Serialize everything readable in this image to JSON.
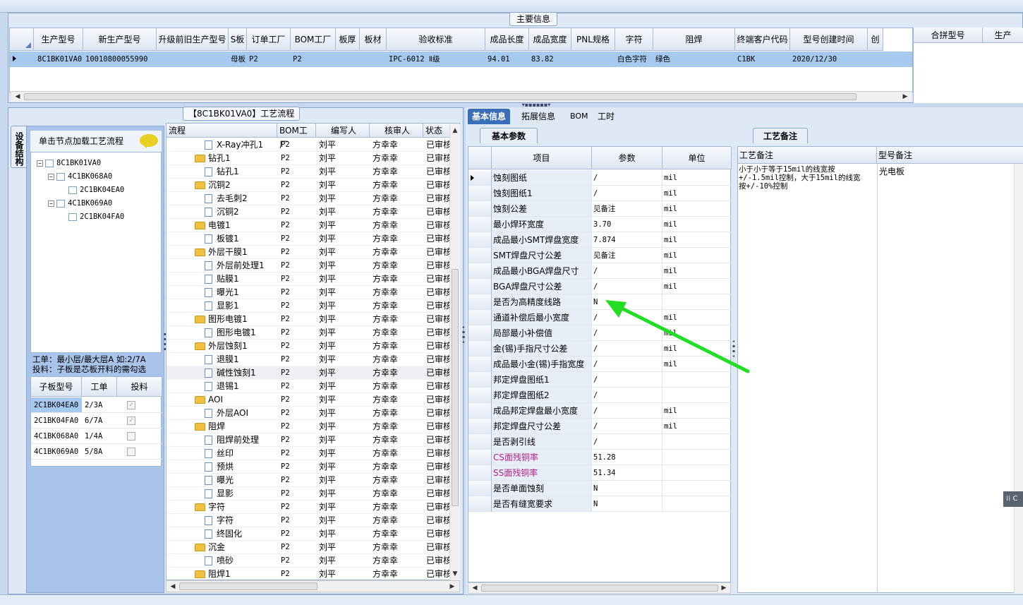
{
  "main_info": {
    "title": "主要信息",
    "columns": [
      "生产型号",
      "新生产型号",
      "升级前旧生产型号",
      "S板",
      "订单工厂",
      "BOM工厂",
      "板厚",
      "板材",
      "验收标准",
      "成品长度",
      "成品宽度",
      "PNL规格",
      "字符",
      "阻焊",
      "终端客户代码",
      "型号创建时间",
      "创"
    ],
    "row": [
      "8C1BK01VA0",
      "10010800055990",
      "",
      "母板",
      "P2",
      "P2",
      "",
      "",
      "IPC-6012 Ⅱ级",
      "94.01",
      "83.82",
      "",
      "白色字符",
      "绿色",
      "C1BK",
      "2020/12/30",
      ""
    ],
    "right_columns": [
      "合拼型号",
      "生产"
    ]
  },
  "process": {
    "title": "【8C1BK01VA0】工艺流程",
    "vertical_tab": "设备结构",
    "click_hint": "单击节点加载工艺流程",
    "tree": [
      {
        "label": "8C1BK01VA0",
        "level": 0,
        "expand": "minus"
      },
      {
        "label": "4C1BK068A0",
        "level": 1,
        "expand": "minus"
      },
      {
        "label": "2C1BK04EA0",
        "level": 2,
        "expand": ""
      },
      {
        "label": "4C1BK069A0",
        "level": 1,
        "expand": "minus"
      },
      {
        "label": "2C1BK04FA0",
        "level": 2,
        "expand": ""
      }
    ],
    "note_line1": "工单：最小层/最大层A 如:2/7A",
    "note_line2": "投料：子板是芯板开料的需勾选",
    "subgrid_headers": [
      "子板型号",
      "工单",
      "投料"
    ],
    "subgrid_rows": [
      {
        "model": "2C1BK04EA0",
        "order": "2/3A",
        "checked": true
      },
      {
        "model": "2C1BK04FA0",
        "order": "6/7A",
        "checked": true
      },
      {
        "model": "4C1BK068A0",
        "order": "1/4A",
        "checked": false
      },
      {
        "model": "4C1BK069A0",
        "order": "5/8A",
        "checked": false
      }
    ],
    "flow_headers": [
      "流程",
      "BOM工厂",
      "编写人",
      "核审人",
      "状态"
    ],
    "flow_rows": [
      {
        "name": "X-Ray冲孔1",
        "type": "doc",
        "bom": "P2",
        "writer": "刘平",
        "reviewer": "方幸幸",
        "status": "已审核"
      },
      {
        "name": "钻孔1",
        "type": "folder",
        "bom": "P2",
        "writer": "刘平",
        "reviewer": "方幸幸",
        "status": "已审核"
      },
      {
        "name": "钻孔1",
        "type": "doc",
        "bom": "P2",
        "writer": "刘平",
        "reviewer": "方幸幸",
        "status": "已审核"
      },
      {
        "name": "沉铜2",
        "type": "folder",
        "bom": "P2",
        "writer": "刘平",
        "reviewer": "方幸幸",
        "status": "已审核"
      },
      {
        "name": "去毛刺2",
        "type": "doc",
        "bom": "P2",
        "writer": "刘平",
        "reviewer": "方幸幸",
        "status": "已审核"
      },
      {
        "name": "沉铜2",
        "type": "doc",
        "bom": "P2",
        "writer": "刘平",
        "reviewer": "方幸幸",
        "status": "已审核"
      },
      {
        "name": "电镀1",
        "type": "folder",
        "bom": "P2",
        "writer": "刘平",
        "reviewer": "方幸幸",
        "status": "已审核"
      },
      {
        "name": "板镀1",
        "type": "doc",
        "bom": "P2",
        "writer": "刘平",
        "reviewer": "方幸幸",
        "status": "已审核"
      },
      {
        "name": "外层干膜1",
        "type": "folder",
        "bom": "P2",
        "writer": "刘平",
        "reviewer": "方幸幸",
        "status": "已审核"
      },
      {
        "name": "外层前处理1",
        "type": "doc",
        "bom": "P2",
        "writer": "刘平",
        "reviewer": "方幸幸",
        "status": "已审核"
      },
      {
        "name": "贴膜1",
        "type": "doc",
        "bom": "P2",
        "writer": "刘平",
        "reviewer": "方幸幸",
        "status": "已审核"
      },
      {
        "name": "曝光1",
        "type": "doc",
        "bom": "P2",
        "writer": "刘平",
        "reviewer": "方幸幸",
        "status": "已审核"
      },
      {
        "name": "显影1",
        "type": "doc",
        "bom": "P2",
        "writer": "刘平",
        "reviewer": "方幸幸",
        "status": "已审核"
      },
      {
        "name": "图形电镀1",
        "type": "folder",
        "bom": "P2",
        "writer": "刘平",
        "reviewer": "方幸幸",
        "status": "已审核"
      },
      {
        "name": "图形电镀1",
        "type": "doc",
        "bom": "P2",
        "writer": "刘平",
        "reviewer": "方幸幸",
        "status": "已审核"
      },
      {
        "name": "外层蚀刻1",
        "type": "folder",
        "bom": "P2",
        "writer": "刘平",
        "reviewer": "方幸幸",
        "status": "已审核"
      },
      {
        "name": "退膜1",
        "type": "doc",
        "bom": "P2",
        "writer": "刘平",
        "reviewer": "方幸幸",
        "status": "已审核"
      },
      {
        "name": "碱性蚀刻1",
        "type": "doc",
        "bom": "P2",
        "writer": "刘平",
        "reviewer": "方幸幸",
        "status": "已审核",
        "selected": true
      },
      {
        "name": "退锡1",
        "type": "doc",
        "bom": "P2",
        "writer": "刘平",
        "reviewer": "方幸幸",
        "status": "已审核"
      },
      {
        "name": "AOI",
        "type": "folder",
        "bom": "P2",
        "writer": "刘平",
        "reviewer": "方幸幸",
        "status": "已审核"
      },
      {
        "name": "外层AOI",
        "type": "doc",
        "bom": "P2",
        "writer": "刘平",
        "reviewer": "方幸幸",
        "status": "已审核"
      },
      {
        "name": "阻焊",
        "type": "folder",
        "bom": "P2",
        "writer": "刘平",
        "reviewer": "方幸幸",
        "status": "已审核"
      },
      {
        "name": "阻焊前处理",
        "type": "doc",
        "bom": "P2",
        "writer": "刘平",
        "reviewer": "方幸幸",
        "status": "已审核"
      },
      {
        "name": "丝印",
        "type": "doc",
        "bom": "P2",
        "writer": "刘平",
        "reviewer": "方幸幸",
        "status": "已审核"
      },
      {
        "name": "预烘",
        "type": "doc",
        "bom": "P2",
        "writer": "刘平",
        "reviewer": "方幸幸",
        "status": "已审核"
      },
      {
        "name": "曝光",
        "type": "doc",
        "bom": "P2",
        "writer": "刘平",
        "reviewer": "方幸幸",
        "status": "已审核"
      },
      {
        "name": "显影",
        "type": "doc",
        "bom": "P2",
        "writer": "刘平",
        "reviewer": "方幸幸",
        "status": "已审核"
      },
      {
        "name": "字符",
        "type": "folder",
        "bom": "P2",
        "writer": "刘平",
        "reviewer": "方幸幸",
        "status": "已审核"
      },
      {
        "name": "字符",
        "type": "doc",
        "bom": "P2",
        "writer": "刘平",
        "reviewer": "方幸幸",
        "status": "已审核"
      },
      {
        "name": "终固化",
        "type": "doc",
        "bom": "P2",
        "writer": "刘平",
        "reviewer": "方幸幸",
        "status": "已审核"
      },
      {
        "name": "沉金",
        "type": "folder",
        "bom": "P2",
        "writer": "刘平",
        "reviewer": "方幸幸",
        "status": "已审核"
      },
      {
        "name": "喷砂",
        "type": "doc",
        "bom": "P2",
        "writer": "刘平",
        "reviewer": "方幸幸",
        "status": "已审核"
      },
      {
        "name": "阻焊1",
        "type": "folder",
        "bom": "P2",
        "writer": "刘平",
        "reviewer": "方幸幸",
        "status": "已审核"
      }
    ]
  },
  "right": {
    "tabs": [
      "基本信息",
      "拓展信息",
      "BOM",
      "工时"
    ],
    "active_tab": "基本信息",
    "basic_tab": "基本参数",
    "remark_tab": "工艺备注",
    "param_headers": [
      "项目",
      "参数",
      "单位"
    ],
    "params": [
      {
        "name": "蚀刻图纸",
        "value": "/",
        "unit": "mil"
      },
      {
        "name": "蚀刻图纸1",
        "value": "/",
        "unit": "mil"
      },
      {
        "name": "蚀刻公差",
        "value": "见备注",
        "unit": "mil"
      },
      {
        "name": "最小焊环宽度",
        "value": "3.70",
        "unit": "mil"
      },
      {
        "name": "成品最小SMT焊盘宽度",
        "value": "7.874",
        "unit": "mil"
      },
      {
        "name": "SMT焊盘尺寸公差",
        "value": "见备注",
        "unit": "mil"
      },
      {
        "name": "成品最小BGA焊盘尺寸",
        "value": "/",
        "unit": "mil"
      },
      {
        "name": "BGA焊盘尺寸公差",
        "value": "/",
        "unit": "mil"
      },
      {
        "name": "是否为高精度线路",
        "value": "N",
        "unit": ""
      },
      {
        "name": "通道补偿后最小宽度",
        "value": "/",
        "unit": "mil"
      },
      {
        "name": "局部最小补偿值",
        "value": "/",
        "unit": "mil"
      },
      {
        "name": "金(锡)手指尺寸公差",
        "value": "/",
        "unit": "mil"
      },
      {
        "name": "成品最小金(锡)手指宽度",
        "value": "/",
        "unit": "mil"
      },
      {
        "name": "邦定焊盘图纸1",
        "value": "/",
        "unit": ""
      },
      {
        "name": "邦定焊盘图纸2",
        "value": "/",
        "unit": ""
      },
      {
        "name": "成品邦定焊盘最小宽度",
        "value": "/",
        "unit": "mil"
      },
      {
        "name": "邦定焊盘尺寸公差",
        "value": "/",
        "unit": "mil"
      },
      {
        "name": "是否剥引线",
        "value": "/",
        "unit": ""
      },
      {
        "name": "CS面残铜率",
        "value": "51.28",
        "unit": "",
        "highlight": "#b0208a"
      },
      {
        "name": "SS面残铜率",
        "value": "51.34",
        "unit": "",
        "highlight": "#b0208a"
      },
      {
        "name": "是否单面蚀刻",
        "value": "N",
        "unit": ""
      },
      {
        "name": "是否有缝宽要求",
        "value": "N",
        "unit": ""
      }
    ],
    "remark_headers": [
      "工艺备注",
      "型号备注"
    ],
    "remark_text": "小于小于等于15mil的线宽按+/-1.5mil控制，大于15mil的线宽按+/-10%控制",
    "model_remark": "光电板",
    "side_button": "C"
  },
  "colors": {
    "selected_row": "#a5c9ef",
    "accent_tab": "#3a6eb8",
    "arrow": "#22dd22"
  }
}
